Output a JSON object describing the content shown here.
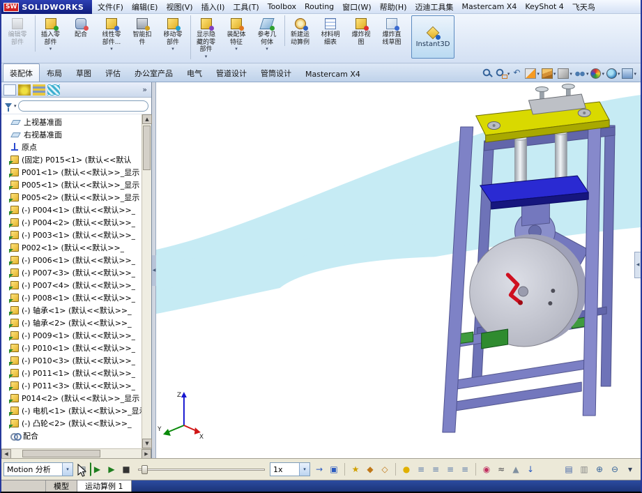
{
  "window": {
    "logo_badge": "SW",
    "logo_text": "SOLIDWORKS"
  },
  "menu": {
    "items": [
      "文件(F)",
      "编辑(E)",
      "视图(V)",
      "插入(I)",
      "工具(T)",
      "Toolbox",
      "Routing",
      "窗口(W)",
      "帮助(H)",
      "迈迪工具集",
      "Mastercam X4",
      "KeyShot 4",
      "飞天鸟"
    ]
  },
  "toolbar": {
    "buttons": [
      {
        "name": "edit-component-button",
        "icon": "edit-component-icon",
        "label": "编辑零部件",
        "cls": "ic-edit disabled"
      },
      {
        "name": "insert-component-button",
        "icon": "insert-component-icon",
        "label": "插入零部件",
        "cls": "ic-insert sep",
        "caret": true
      },
      {
        "name": "mate-button",
        "icon": "mate-icon",
        "label": "配合",
        "cls": "ic-mate"
      },
      {
        "name": "linear-pattern-button",
        "icon": "linear-pattern-icon",
        "label": "线性零部件...",
        "cls": "ic-linear",
        "caret": true
      },
      {
        "name": "smart-fasteners-button",
        "icon": "smart-fastener-icon",
        "label": "智能扣件",
        "cls": "ic-fastener"
      },
      {
        "name": "move-component-button",
        "icon": "move-component-icon",
        "label": "移动零部件",
        "cls": "ic-move",
        "caret": true
      },
      {
        "name": "show-hidden-components-button",
        "icon": "show-hidden-icon",
        "label": "显示隐藏的零部件",
        "cls": "ic-showhide sep",
        "caret": true
      },
      {
        "name": "assembly-features-button",
        "icon": "assembly-features-icon",
        "label": "装配体特征",
        "cls": "ic-features",
        "caret": true
      },
      {
        "name": "reference-geometry-button",
        "icon": "reference-geometry-icon",
        "label": "参考几何体",
        "cls": "ic-refgeo",
        "caret": true
      },
      {
        "name": "new-motion-study-button",
        "icon": "new-motion-study-icon",
        "label": "新建运动算例",
        "cls": "ic-motion sep"
      },
      {
        "name": "bill-of-materials-button",
        "icon": "bom-icon",
        "label": "材料明细表",
        "cls": "ic-bom"
      },
      {
        "name": "exploded-view-button",
        "icon": "exploded-view-icon",
        "label": "爆炸视图",
        "cls": "ic-explode"
      },
      {
        "name": "explode-line-sketch-button",
        "icon": "explode-sketch-icon",
        "label": "爆炸直线草图",
        "cls": "ic-explodesketch"
      },
      {
        "name": "instant3d-button",
        "icon": "instant3d-icon",
        "label": "Instant3D",
        "cls": "ic-instant3d instant3d sep"
      }
    ]
  },
  "command_tabs": {
    "tabs": [
      {
        "label": "装配体",
        "cls": "active"
      },
      {
        "label": "布局"
      },
      {
        "label": "草图"
      },
      {
        "label": "评估"
      },
      {
        "label": "办公室产品"
      },
      {
        "label": "电气"
      },
      {
        "label": "管道设计"
      },
      {
        "label": "管筒设计"
      },
      {
        "label": "Mastercam X4"
      }
    ]
  },
  "view_toolbar": {
    "icons": [
      {
        "name": "zoom-fit-icon",
        "cls": "vi-zoomfit"
      },
      {
        "name": "zoom-area-icon",
        "cls": "vi-zoomarea",
        "caret": true
      },
      {
        "name": "previous-view-icon",
        "cls": "vi-prev"
      },
      {
        "name": "section-view-icon",
        "cls": "vi-section",
        "caret": true
      },
      {
        "name": "view-orientation-icon",
        "cls": "vi-orient",
        "caret": true
      },
      {
        "name": "display-style-icon",
        "cls": "vi-display",
        "caret": true
      },
      {
        "name": "hide-show-items-icon",
        "cls": "vi-hideshow",
        "caret": true
      },
      {
        "name": "edit-appearance-icon",
        "cls": "vi-appearance",
        "caret": true
      },
      {
        "name": "apply-scene-icon",
        "cls": "vi-scene",
        "caret": true
      },
      {
        "name": "view-settings-icon",
        "cls": "vi-settings",
        "caret": true
      }
    ]
  },
  "panel": {
    "tabs": [
      {
        "name": "featuremanager-tab-icon",
        "cls": "pt-feature active"
      },
      {
        "name": "propertymanager-tab-icon",
        "cls": "pt-property"
      },
      {
        "name": "configurationmanager-tab-icon",
        "cls": "pt-config"
      },
      {
        "name": "displaymanager-tab-icon",
        "cls": "pt-display"
      }
    ],
    "flyout": "»",
    "filter": {
      "value": "",
      "placeholder": ""
    },
    "tree": [
      {
        "type": "plane",
        "label": "上视基准面"
      },
      {
        "type": "plane",
        "label": "右视基准面"
      },
      {
        "type": "origin",
        "label": "原点"
      },
      {
        "type": "component",
        "label": "(固定) P015<1> (默认<<默认"
      },
      {
        "type": "component",
        "label": "P001<1> (默认<<默认>>_显示"
      },
      {
        "type": "component",
        "label": "P005<1> (默认<<默认>>_显示"
      },
      {
        "type": "component",
        "label": "P005<2> (默认<<默认>>_显示"
      },
      {
        "type": "component",
        "label": "(-) P004<1> (默认<<默认>>_"
      },
      {
        "type": "component",
        "label": "(-) P004<2> (默认<<默认>>_"
      },
      {
        "type": "component",
        "label": "(-) P003<1> (默认<<默认>>_"
      },
      {
        "type": "component",
        "label": "P002<1> (默认<<默认>>_"
      },
      {
        "type": "component",
        "label": "(-) P006<1> (默认<<默认>>_"
      },
      {
        "type": "component",
        "label": "(-) P007<3> (默认<<默认>>_"
      },
      {
        "type": "component",
        "label": "(-) P007<4> (默认<<默认>>_"
      },
      {
        "type": "component",
        "label": "(-) P008<1> (默认<<默认>>_"
      },
      {
        "type": "component",
        "label": "(-) 轴承<1> (默认<<默认>>_"
      },
      {
        "type": "component",
        "label": "(-) 轴承<2> (默认<<默认>>_"
      },
      {
        "type": "component",
        "label": "(-) P009<1> (默认<<默认>>_"
      },
      {
        "type": "component",
        "label": "(-) P010<1> (默认<<默认>>_"
      },
      {
        "type": "component",
        "label": "(-) P010<3> (默认<<默认>>_"
      },
      {
        "type": "component",
        "label": "(-) P011<1> (默认<<默认>>_"
      },
      {
        "type": "component",
        "label": "(-) P011<3> (默认<<默认>>_"
      },
      {
        "type": "component",
        "label": "P014<2> (默认<<默认>>_显示"
      },
      {
        "type": "component",
        "label": "(-) 电机<1> (默认<<默认>>_显示"
      },
      {
        "type": "component",
        "label": "(-) 凸轮<2> (默认<<默认>>_"
      },
      {
        "type": "mates",
        "label": "配合"
      }
    ]
  },
  "viewport": {
    "triad": {
      "x": "X",
      "y": "Y",
      "z": "Z"
    },
    "colors": {
      "swoosh": "#c6ebf4",
      "frame": "#7b7fc4",
      "plate_yellow": "#d9d900",
      "plate_blue": "#2a2ad2",
      "drum": "#c6c8d0",
      "crank_red": "#cf1020",
      "bracket_green": "#2f8b2f"
    }
  },
  "motion": {
    "study_type": "Motion 分析",
    "speed": "1x",
    "icons_play": [
      {
        "name": "calculate-icon",
        "cls": "mi-calc",
        "glyph": "▦"
      },
      {
        "name": "play-from-start-icon",
        "cls": "mi-playstart",
        "glyph": "▶"
      },
      {
        "name": "play-icon",
        "cls": "mi-play",
        "glyph": "▶"
      },
      {
        "name": "stop-icon",
        "cls": "mi-stop",
        "glyph": "■"
      }
    ],
    "icons_mode": [
      {
        "name": "playback-mode-icon",
        "cls": "mi-mode",
        "glyph": "→"
      },
      {
        "name": "save-animation-icon",
        "cls": "mi-save",
        "glyph": "▣"
      }
    ],
    "icons_tools": [
      {
        "name": "animation-wizard-icon",
        "cls": "mi-wizard",
        "glyph": "★"
      },
      {
        "name": "autokey-icon",
        "cls": "mi-autokey",
        "glyph": "◆"
      },
      {
        "name": "add-key-icon",
        "cls": "mi-addkey",
        "glyph": "◇"
      }
    ],
    "icons_filters": [
      {
        "name": "filter-none-icon",
        "cls": "mi-fnone",
        "glyph": "●"
      },
      {
        "name": "filter-animated-icon",
        "cls": "mi-f1",
        "glyph": "≡"
      },
      {
        "name": "filter-driving-icon",
        "cls": "mi-f2",
        "glyph": "≡"
      },
      {
        "name": "filter-selected-icon",
        "cls": "mi-f3",
        "glyph": "≡"
      },
      {
        "name": "filter-results-icon",
        "cls": "mi-f4",
        "glyph": "≡"
      }
    ],
    "icons_elements": [
      {
        "name": "motor-icon",
        "cls": "mi-motor",
        "glyph": "◉"
      },
      {
        "name": "spring-icon",
        "cls": "mi-spring",
        "glyph": "≈"
      },
      {
        "name": "contact-icon",
        "cls": "mi-contact",
        "glyph": "▲"
      },
      {
        "name": "gravity-icon",
        "cls": "mi-gravity",
        "glyph": "↓"
      }
    ],
    "icons_right": [
      {
        "name": "results-plots-icon",
        "cls": "mi-results",
        "glyph": "▤"
      },
      {
        "name": "study-properties-icon",
        "cls": "mi-props",
        "glyph": "▥"
      },
      {
        "name": "zoom-in-timeline-icon",
        "cls": "mi-zin",
        "glyph": "⊕"
      },
      {
        "name": "zoom-out-timeline-icon",
        "cls": "mi-zout",
        "glyph": "⊖"
      },
      {
        "name": "collapse-manager-icon",
        "cls": "mi-collapse",
        "glyph": "▾"
      }
    ]
  },
  "bottom_tabs": {
    "tabs": [
      {
        "name": "model-tab",
        "label": "模型"
      },
      {
        "name": "motion-study-tab",
        "label": "运动算例 1",
        "cls": "active"
      }
    ]
  }
}
